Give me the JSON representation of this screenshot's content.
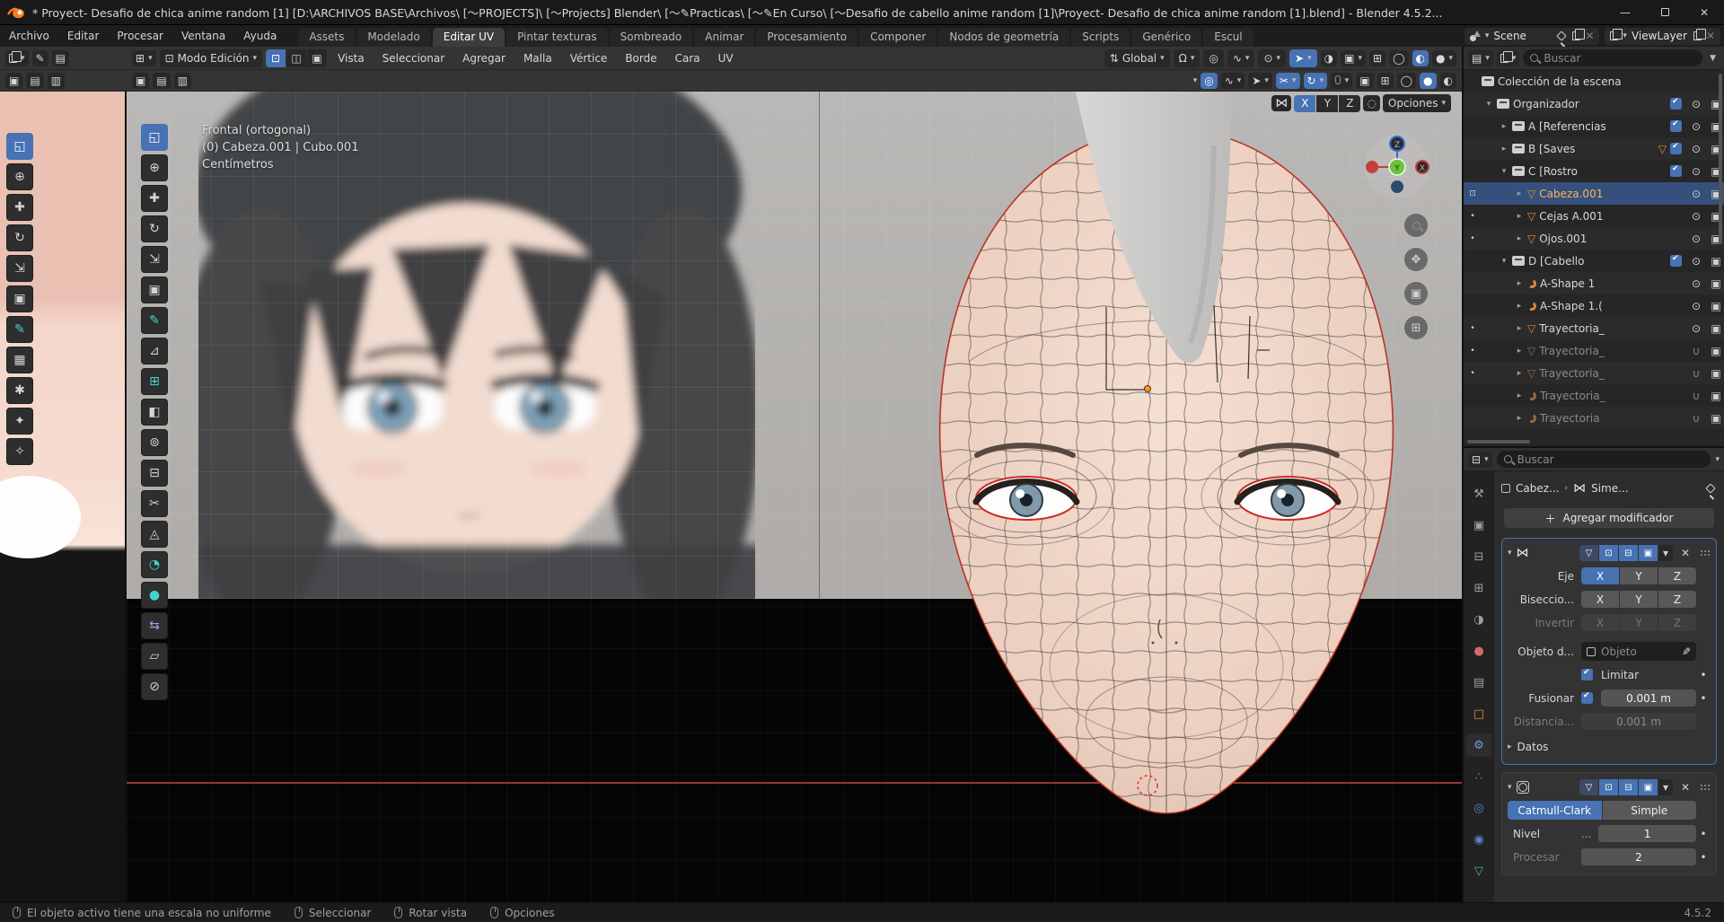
{
  "window": {
    "title": "* Proyect- Desafio de chica anime random [1] [D:\\ARCHIVOS BASE\\Archivos\\ [〜PROJECTS]\\ [〜Projects] Blender\\ [〜✎Practicas\\ [〜✎En Curso\\ [〜Desafio de cabello anime random [1]\\Proyect- Desafio de chica anime random [1].blend] - Blender 4.5.2...",
    "minimize": "—",
    "close": "✕"
  },
  "topbar": {
    "menus": [
      "Archivo",
      "Editar",
      "Procesar",
      "Ventana",
      "Ayuda"
    ],
    "tabs": [
      "Assets",
      "Modelado",
      "Editar UV",
      "Pintar texturas",
      "Sombreado",
      "Animar",
      "Procesamiento",
      "Componer",
      "Nodos de geometría",
      "Scripts",
      "Genérico",
      "Escul"
    ],
    "active_tab": "Editar UV",
    "scene_label": "Scene",
    "viewlayer_label": "ViewLayer"
  },
  "viewport_header": {
    "mode": "Modo Edición",
    "menus": [
      "Vista",
      "Seleccionar",
      "Agregar",
      "Malla",
      "Vértice",
      "Borde",
      "Cara",
      "UV"
    ],
    "orientation": "Global"
  },
  "mirror_bar": {
    "axes": [
      "X",
      "Y",
      "Z"
    ],
    "active_axis": "X",
    "options_label": "Opciones"
  },
  "viewport": {
    "overlay_line1": "Frontal (ortogonal)",
    "overlay_line2": "(0) Cabeza.001 | Cubo.001",
    "overlay_line3": "Centímetros"
  },
  "gizmo": {
    "z_label": "Z",
    "y_label": "Y",
    "x_label": "X"
  },
  "toolbars": {
    "uv": [
      {
        "name": "select-box-tool",
        "glyph": "◱"
      },
      {
        "name": "cursor-tool",
        "glyph": "⊕"
      },
      {
        "name": "move-tool",
        "glyph": "✚"
      },
      {
        "name": "rotate-tool",
        "glyph": "↻"
      },
      {
        "name": "scale-tool",
        "glyph": "⇲"
      },
      {
        "name": "transform-tool",
        "glyph": "▣"
      },
      {
        "name": "annotate-tool",
        "glyph": "✎"
      },
      {
        "name": "rip-region-tool",
        "glyph": "▦"
      },
      {
        "name": "grab-tool",
        "glyph": "✱"
      },
      {
        "name": "relax-tool",
        "glyph": "✦"
      },
      {
        "name": "pinch-tool",
        "glyph": "✧"
      }
    ],
    "vp": [
      {
        "name": "select-box-tool",
        "glyph": "◱"
      },
      {
        "name": "cursor-tool",
        "glyph": "⊕"
      },
      {
        "name": "move-tool",
        "glyph": "✚"
      },
      {
        "name": "rotate-tool",
        "glyph": "↻"
      },
      {
        "name": "scale-tool",
        "glyph": "⇲"
      },
      {
        "name": "transform-tool",
        "glyph": "▣"
      },
      {
        "name": "annotate-tool",
        "glyph": "✎"
      },
      {
        "name": "measure-tool",
        "glyph": "⊿"
      },
      {
        "name": "add-cube-tool",
        "glyph": "⊞"
      },
      {
        "name": "extrude-tool",
        "glyph": "◧"
      },
      {
        "name": "inset-tool",
        "glyph": "⊚"
      },
      {
        "name": "loop-cut-tool",
        "glyph": "⊟"
      },
      {
        "name": "knife-tool",
        "glyph": "✂"
      },
      {
        "name": "poly-build-tool",
        "glyph": "◬"
      },
      {
        "name": "spin-tool",
        "glyph": "◔"
      },
      {
        "name": "smooth-tool",
        "glyph": "●"
      },
      {
        "name": "edge-slide-tool",
        "glyph": "⇆"
      },
      {
        "name": "shear-tool",
        "glyph": "▱"
      },
      {
        "name": "rip-tool",
        "glyph": "⊘"
      }
    ]
  },
  "outliner": {
    "search_placeholder": "Buscar",
    "items": [
      {
        "name": "Colección de la escena"
      },
      {
        "name": "Organizador"
      },
      {
        "name": "A [Referencias"
      },
      {
        "name": "B [Saves"
      },
      {
        "name": "C [Rostro"
      },
      {
        "name": "Cabeza.001"
      },
      {
        "name": "Cejas A.001"
      },
      {
        "name": "Ojos.001"
      },
      {
        "name": "D [Cabello"
      },
      {
        "name": "A-Shape 1"
      },
      {
        "name": "A-Shape 1.("
      },
      {
        "name": "Trayectoria_"
      },
      {
        "name": "Trayectoria_"
      },
      {
        "name": "Trayectoria_"
      },
      {
        "name": "Trayectoria_"
      },
      {
        "name": "Trayectoria"
      }
    ]
  },
  "properties": {
    "search_placeholder": "Buscar",
    "breadcrumb_object": "Cabez...",
    "breadcrumb_modifier": "Sime...",
    "add_modifier": "Agregar modificador",
    "mirror": {
      "eje_label": "Eje",
      "bisect_label": "Biseccio...",
      "flip_label": "Invertir",
      "axes": [
        "X",
        "Y",
        "Z"
      ],
      "object_label": "Objeto d...",
      "object_value": "Objeto",
      "limit_label": "Limitar",
      "merge_label": "Fusionar",
      "merge_value": "0.001 m",
      "distance_label": "Distancia...",
      "distance_value": "0.001 m",
      "datos_label": "Datos"
    },
    "subdiv": {
      "type_catmull": "Catmull-Clark",
      "type_simple": "Simple",
      "level_label": "Nivel",
      "level_dots": "...",
      "level_value": "1",
      "render_label": "Procesar",
      "render_value": "2"
    }
  },
  "status_bar": {
    "msg1": "El objeto activo tiene una escala no uniforme",
    "msg2": "Seleccionar",
    "msg3": "Rotar vista",
    "msg4": "Opciones",
    "version": "4.5.2"
  },
  "colors": {
    "accent_blue": "#4772b3",
    "selection_blue": "#35507c",
    "mesh_icon_orange": "#e08c3a",
    "red_outline": "#b5261b"
  }
}
